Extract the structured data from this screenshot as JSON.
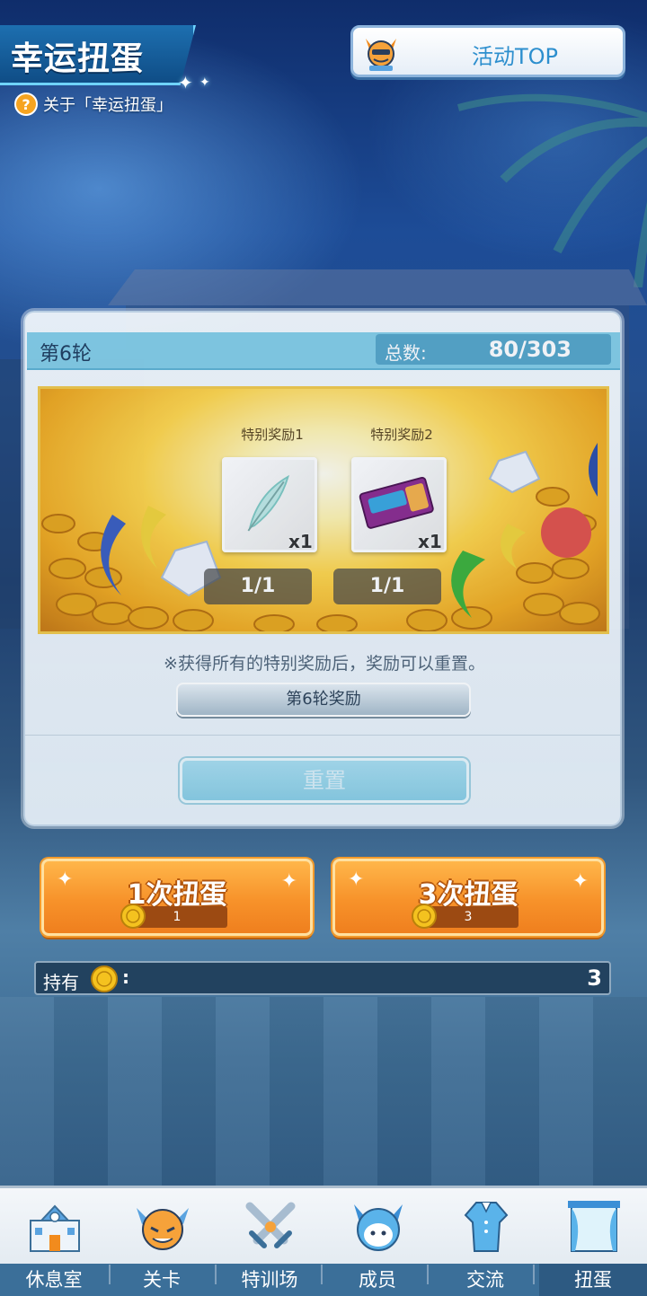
{
  "header": {
    "title": "幸运扭蛋",
    "about_text": "关于「幸运扭蛋」",
    "about_icon": "help-icon",
    "event_top_label": "活动TOP",
    "event_top_icon": "demon-mascot-icon"
  },
  "panel": {
    "round_label": "第6轮",
    "total_label": "总数:",
    "total_value": "80/303",
    "rewards": [
      {
        "title": "特别奖励1",
        "qty": "x1",
        "count": "1/1",
        "item_icon": "feather-icon"
      },
      {
        "title": "特别奖励2",
        "qty": "x1",
        "count": "1/1",
        "item_icon": "super-cookie-ticket-icon"
      }
    ],
    "note": "※获得所有的特别奖励后，奖励可以重置。",
    "round_reward_button": "第6轮奖励",
    "reset_button": "重置"
  },
  "draws": [
    {
      "label": "1次扭蛋",
      "cost": "1"
    },
    {
      "label": "3次扭蛋",
      "cost": "3"
    }
  ],
  "holdings": {
    "label": "持有",
    "colon": ":",
    "value": "3",
    "icon": "gold-coin-icon"
  },
  "nav": [
    {
      "label": "休息室",
      "icon": "school-building-icon",
      "active": false
    },
    {
      "label": "关卡",
      "icon": "demon-mascot-icon",
      "active": false
    },
    {
      "label": "特训场",
      "icon": "crossed-swords-icon",
      "active": false
    },
    {
      "label": "成员",
      "icon": "member-mascot-icon",
      "active": false
    },
    {
      "label": "交流",
      "icon": "outfit-icon",
      "active": false
    },
    {
      "label": "扭蛋",
      "icon": "curtain-window-icon",
      "active": true
    }
  ],
  "colors": {
    "accent_blue": "#2d8fce",
    "panel_header": "#84cde6",
    "draw_orange": "#f7922a",
    "nav_label_bg": "#3b6f99"
  }
}
